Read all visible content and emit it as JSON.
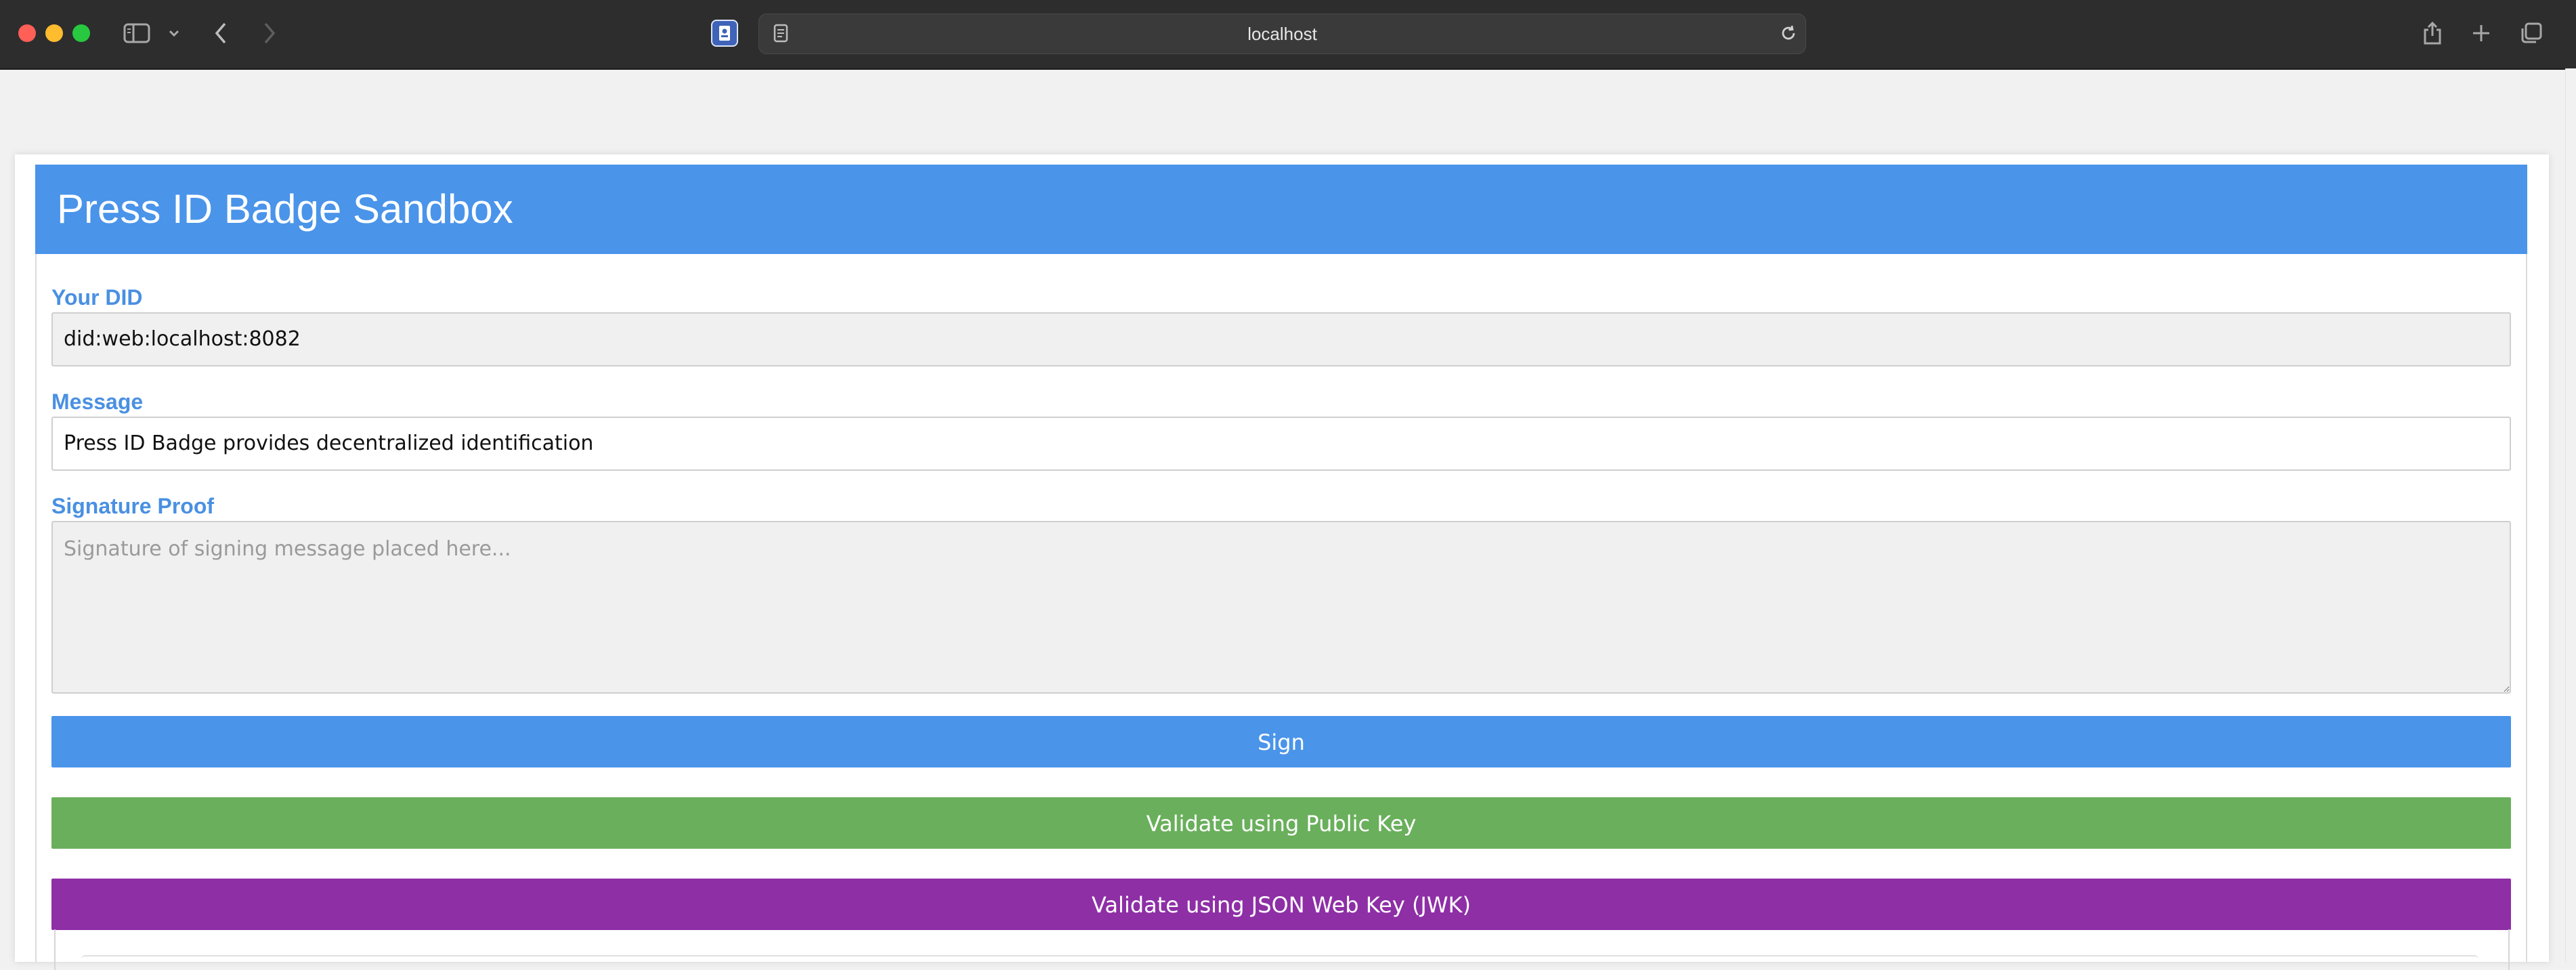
{
  "browser": {
    "url": "localhost",
    "icons": {
      "close": "close-dot",
      "minimize": "minimize-dot",
      "zoom": "zoom-dot",
      "sidebar": "sidebar-icon",
      "chevron": "chevron-down-icon",
      "back": "back-icon",
      "forward": "forward-icon",
      "favicon": "badge-icon",
      "reader": "reader-icon",
      "reload": "reload-icon",
      "share": "share-icon",
      "new_tab": "plus-icon",
      "tabs": "tabs-overview-icon"
    }
  },
  "app": {
    "title": "Press ID Badge Sandbox",
    "accent": "#4a94ea"
  },
  "form": {
    "did_label": "Your DID",
    "did_value": "did:web:localhost:8082",
    "message_label": "Message",
    "message_value": "Press ID Badge provides decentralized identification",
    "signature_label": "Signature Proof",
    "signature_placeholder": "Signature of signing message placed here..."
  },
  "buttons": {
    "sign": {
      "label": "Sign",
      "color": "#4a94ea"
    },
    "validate_public_key": {
      "label": "Validate using Public Key",
      "color": "#6aaf5c"
    },
    "validate_jwk": {
      "label": "Validate using JSON Web Key (JWK)",
      "color": "#8e2fa6"
    }
  }
}
